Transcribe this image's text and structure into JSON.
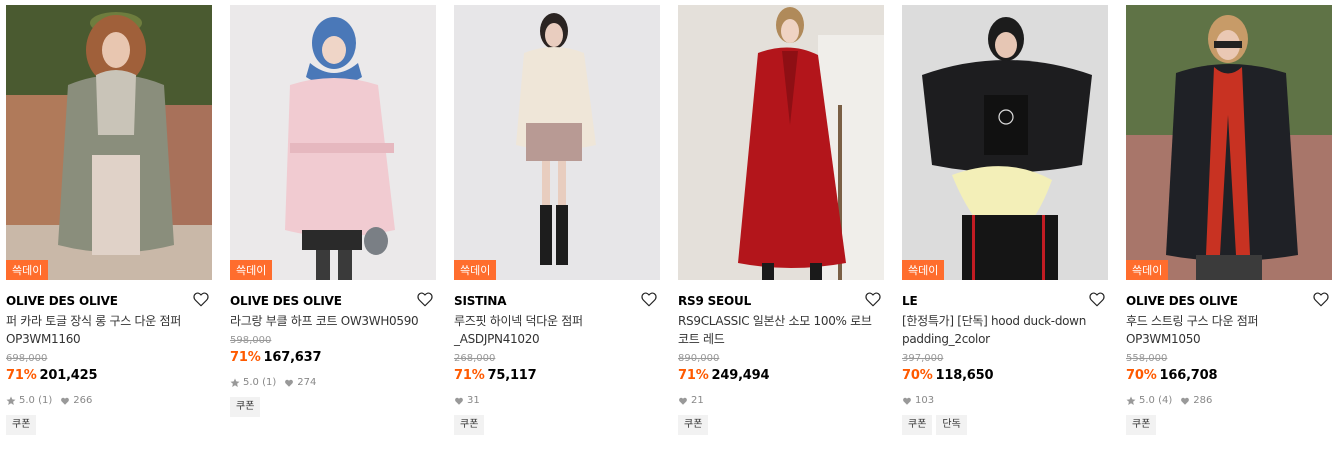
{
  "event_badge": "쓱데이",
  "products": [
    {
      "brand": "OLIVE DES OLIVE",
      "name_line1": "퍼 카라 토글 장식 롱 구스 다운 점퍼",
      "name_line2": "OP3WM1160",
      "original_price": "698,000",
      "discount": "71%",
      "price": "201,425",
      "rating": "5.0",
      "rating_count": "(1)",
      "likes": "266",
      "tags": [
        "쿠폰"
      ],
      "badge": true
    },
    {
      "brand": "OLIVE DES OLIVE",
      "name_line1": "라그랑 부클 하프 코트 OW3WH0590",
      "name_line2": "",
      "original_price": "598,000",
      "discount": "71%",
      "price": "167,637",
      "rating": "5.0",
      "rating_count": "(1)",
      "likes": "274",
      "tags": [
        "쿠폰"
      ],
      "badge": true
    },
    {
      "brand": "SISTINA",
      "name_line1": "루즈핏 하이넥 덕다운 점퍼",
      "name_line2": "_ASDJPN41020",
      "original_price": "268,000",
      "discount": "71%",
      "price": "75,117",
      "rating": "",
      "rating_count": "",
      "likes": "31",
      "tags": [
        "쿠폰"
      ],
      "badge": true
    },
    {
      "brand": "RS9 SEOUL",
      "name_line1": "RS9CLASSIC 일본산 소모 100% 로브",
      "name_line2": "코트 레드",
      "original_price": "890,000",
      "discount": "71%",
      "price": "249,494",
      "rating": "",
      "rating_count": "",
      "likes": "21",
      "tags": [
        "쿠폰"
      ],
      "badge": false
    },
    {
      "brand": "LE",
      "name_line1": "[한정특가] [단독] hood duck-down",
      "name_line2": "padding_2color",
      "original_price": "397,000",
      "discount": "70%",
      "price": "118,650",
      "rating": "",
      "rating_count": "",
      "likes": "103",
      "tags": [
        "쿠폰",
        "단독"
      ],
      "badge": true
    },
    {
      "brand": "OLIVE DES OLIVE",
      "name_line1": "후드 스트링 구스 다운 점퍼",
      "name_line2": "OP3WM1050",
      "original_price": "558,000",
      "discount": "70%",
      "price": "166,708",
      "rating": "5.0",
      "rating_count": "(4)",
      "likes": "286",
      "tags": [
        "쿠폰"
      ],
      "badge": true
    }
  ],
  "colors": {
    "badge_bg": "#ff6d2d",
    "discount": "#ff5a00",
    "original_price": "#999999",
    "tag_bg": "#f2f2f2"
  },
  "icons": [
    "heart-outline-icon",
    "star-icon",
    "heart-filled-icon"
  ]
}
